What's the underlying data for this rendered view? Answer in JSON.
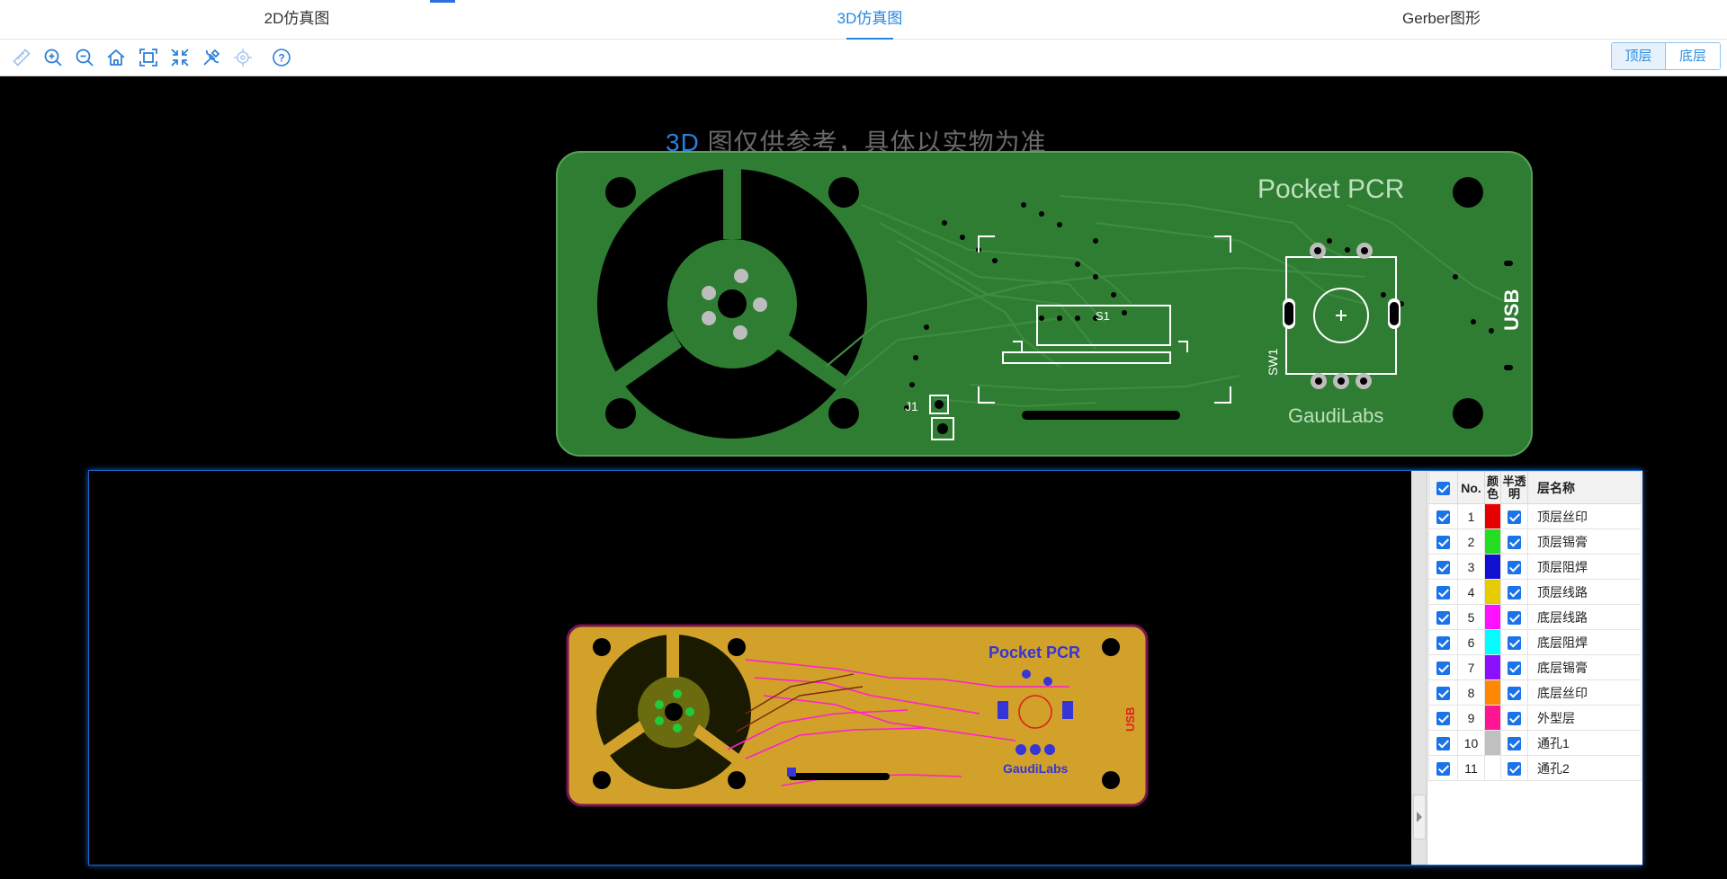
{
  "tabs": [
    {
      "label": "2D仿真图",
      "active": false
    },
    {
      "label": "3D仿真图",
      "active": true
    },
    {
      "label": "Gerber图形",
      "active": false
    }
  ],
  "toolbar": {
    "icons": [
      "ruler-icon",
      "zoom-in-icon",
      "zoom-out-icon",
      "home-icon",
      "fit-view-icon",
      "shrink-icon",
      "tools-icon",
      "locate-icon",
      "help-icon"
    ],
    "layer_top": "顶层",
    "layer_bottom": "底层"
  },
  "notice": {
    "highlight": "3D",
    "text": "图仅供参考，具体以实物为准"
  },
  "board": {
    "title": "Pocket PCR",
    "brand": "GaudiLabs",
    "usb": "USB",
    "sw": "SW1",
    "s1": "S1",
    "j1": "J1",
    "green": "#2e7d32",
    "gold": "#c9a227"
  },
  "layers": {
    "headers": {
      "no": "No.",
      "color": "颜色",
      "transparent": "半透明",
      "name": "层名称"
    },
    "rows": [
      {
        "no": "1",
        "color": "#e60000",
        "name": "顶层丝印"
      },
      {
        "no": "2",
        "color": "#22dd22",
        "name": "顶层锡膏"
      },
      {
        "no": "3",
        "color": "#1010d0",
        "name": "顶层阻焊"
      },
      {
        "no": "4",
        "color": "#e6cc00",
        "name": "顶层线路"
      },
      {
        "no": "5",
        "color": "#ff10ff",
        "name": "底层线路"
      },
      {
        "no": "6",
        "color": "#00ffff",
        "name": "底层阻焊"
      },
      {
        "no": "7",
        "color": "#8a10ff",
        "name": "底层锡膏"
      },
      {
        "no": "8",
        "color": "#ff8800",
        "name": "底层丝印"
      },
      {
        "no": "9",
        "color": "#ff1493",
        "name": "外型层"
      },
      {
        "no": "10",
        "color": "#c0c0c0",
        "name": "通孔1"
      },
      {
        "no": "11",
        "color": "#ffffff",
        "name": "通孔2"
      }
    ]
  }
}
